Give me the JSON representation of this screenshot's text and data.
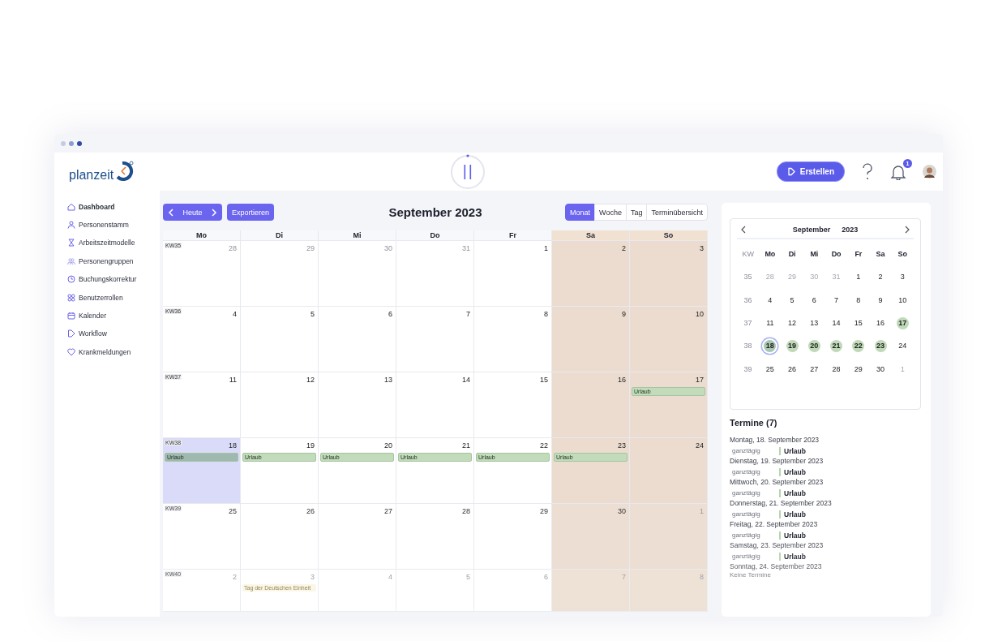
{
  "logo": {
    "text": "planzeit"
  },
  "header": {
    "create_button": "Erstellen",
    "notifications": "1"
  },
  "sidebar": {
    "items": [
      {
        "label": "Dashboard",
        "selected": true
      },
      {
        "label": "Personenstamm",
        "selected": false
      },
      {
        "label": "Arbeitszeitmodelle",
        "selected": false
      },
      {
        "label": "Personengruppen",
        "selected": false
      },
      {
        "label": "Buchungskorrektur",
        "selected": false
      },
      {
        "label": "Benutzerrollen",
        "selected": false
      },
      {
        "label": "Kalender",
        "selected": false
      },
      {
        "label": "Workflow",
        "selected": false
      },
      {
        "label": "Krankmeldungen",
        "selected": false
      }
    ]
  },
  "toolbar": {
    "today": "Heute",
    "export": "Exportieren",
    "title": "September 2023",
    "views": [
      {
        "label": "Monat",
        "selected": true
      },
      {
        "label": "Woche",
        "selected": false
      },
      {
        "label": "Tag",
        "selected": false
      },
      {
        "label": "Terminübersicht",
        "selected": false
      }
    ]
  },
  "calendar": {
    "columns": [
      {
        "label": "Mo",
        "weekend": false
      },
      {
        "label": "Di",
        "weekend": false
      },
      {
        "label": "Mi",
        "weekend": false
      },
      {
        "label": "Do",
        "weekend": false
      },
      {
        "label": "Fr",
        "weekend": false
      },
      {
        "label": "Sa",
        "weekend": true
      },
      {
        "label": "So",
        "weekend": true
      }
    ],
    "weeks": [
      {
        "kw": "KW35",
        "days": [
          {
            "num": "28",
            "muted": true,
            "selected": false
          },
          {
            "num": "29",
            "muted": true,
            "selected": false
          },
          {
            "num": "30",
            "muted": true,
            "selected": false
          },
          {
            "num": "31",
            "muted": true,
            "selected": false
          },
          {
            "num": "1",
            "muted": false,
            "selected": false
          },
          {
            "num": "2",
            "muted": false,
            "selected": false
          },
          {
            "num": "3",
            "muted": false,
            "selected": false
          }
        ]
      },
      {
        "kw": "KW36",
        "days": [
          {
            "num": "4",
            "muted": false,
            "selected": false
          },
          {
            "num": "5",
            "muted": false,
            "selected": false
          },
          {
            "num": "6",
            "muted": false,
            "selected": false
          },
          {
            "num": "7",
            "muted": false,
            "selected": false
          },
          {
            "num": "8",
            "muted": false,
            "selected": false
          },
          {
            "num": "9",
            "muted": false,
            "selected": false
          },
          {
            "num": "10",
            "muted": false,
            "selected": false
          }
        ]
      },
      {
        "kw": "KW37",
        "days": [
          {
            "num": "11",
            "muted": false,
            "selected": false
          },
          {
            "num": "12",
            "muted": false,
            "selected": false
          },
          {
            "num": "13",
            "muted": false,
            "selected": false
          },
          {
            "num": "14",
            "muted": false,
            "selected": false
          },
          {
            "num": "15",
            "muted": false,
            "selected": false
          },
          {
            "num": "16",
            "muted": false,
            "selected": false
          },
          {
            "num": "17",
            "muted": false,
            "selected": false,
            "events": [
              {
                "label": "Urlaub",
                "kind": "vacation"
              }
            ]
          }
        ]
      },
      {
        "kw": "KW38",
        "days": [
          {
            "num": "18",
            "muted": false,
            "selected": true,
            "events": [
              {
                "label": "Urlaub",
                "kind": "vacation"
              }
            ]
          },
          {
            "num": "19",
            "muted": false,
            "selected": false,
            "events": [
              {
                "label": "Urlaub",
                "kind": "vacation"
              }
            ]
          },
          {
            "num": "20",
            "muted": false,
            "selected": false,
            "events": [
              {
                "label": "Urlaub",
                "kind": "vacation"
              }
            ]
          },
          {
            "num": "21",
            "muted": false,
            "selected": false,
            "events": [
              {
                "label": "Urlaub",
                "kind": "vacation"
              }
            ]
          },
          {
            "num": "22",
            "muted": false,
            "selected": false,
            "events": [
              {
                "label": "Urlaub",
                "kind": "vacation"
              }
            ]
          },
          {
            "num": "23",
            "muted": false,
            "selected": false,
            "events": [
              {
                "label": "Urlaub",
                "kind": "vacation"
              }
            ]
          },
          {
            "num": "24",
            "muted": false,
            "selected": false
          }
        ]
      },
      {
        "kw": "KW39",
        "days": [
          {
            "num": "25",
            "muted": false,
            "selected": false
          },
          {
            "num": "26",
            "muted": false,
            "selected": false
          },
          {
            "num": "27",
            "muted": false,
            "selected": false
          },
          {
            "num": "28",
            "muted": false,
            "selected": false
          },
          {
            "num": "29",
            "muted": false,
            "selected": false
          },
          {
            "num": "30",
            "muted": false,
            "selected": false
          },
          {
            "num": "1",
            "muted": true,
            "selected": false
          }
        ]
      },
      {
        "kw": "KW40",
        "days": [
          {
            "num": "2",
            "muted": true,
            "selected": false
          },
          {
            "num": "3",
            "muted": true,
            "selected": false,
            "events": [
              {
                "label": "Tag der Deutschen Einheit",
                "kind": "holiday"
              }
            ]
          },
          {
            "num": "4",
            "muted": true,
            "selected": false
          },
          {
            "num": "5",
            "muted": true,
            "selected": false
          },
          {
            "num": "6",
            "muted": true,
            "selected": false
          },
          {
            "num": "7",
            "muted": true,
            "selected": false
          },
          {
            "num": "8",
            "muted": true,
            "selected": false
          }
        ]
      }
    ]
  },
  "mini_calendar": {
    "month": "September",
    "year": "2023",
    "columns": [
      "KW",
      "Mo",
      "Di",
      "Mi",
      "Do",
      "Fr",
      "Sa",
      "So"
    ],
    "weeks": [
      {
        "kw": "35",
        "days": [
          {
            "num": "28",
            "muted": true,
            "marked": false,
            "selected": false
          },
          {
            "num": "29",
            "muted": true,
            "marked": false,
            "selected": false
          },
          {
            "num": "30",
            "muted": true,
            "marked": false,
            "selected": false
          },
          {
            "num": "31",
            "muted": true,
            "marked": false,
            "selected": false
          },
          {
            "num": "1",
            "muted": false,
            "marked": false,
            "selected": false
          },
          {
            "num": "2",
            "muted": false,
            "marked": false,
            "selected": false
          },
          {
            "num": "3",
            "muted": false,
            "marked": false,
            "selected": false
          }
        ]
      },
      {
        "kw": "36",
        "days": [
          {
            "num": "4",
            "muted": false,
            "marked": false,
            "selected": false
          },
          {
            "num": "5",
            "muted": false,
            "marked": false,
            "selected": false
          },
          {
            "num": "6",
            "muted": false,
            "marked": false,
            "selected": false
          },
          {
            "num": "7",
            "muted": false,
            "marked": false,
            "selected": false
          },
          {
            "num": "8",
            "muted": false,
            "marked": false,
            "selected": false
          },
          {
            "num": "9",
            "muted": false,
            "marked": false,
            "selected": false
          },
          {
            "num": "10",
            "muted": false,
            "marked": false,
            "selected": false
          }
        ]
      },
      {
        "kw": "37",
        "days": [
          {
            "num": "11",
            "muted": false,
            "marked": false,
            "selected": false
          },
          {
            "num": "12",
            "muted": false,
            "marked": false,
            "selected": false
          },
          {
            "num": "13",
            "muted": false,
            "marked": false,
            "selected": false
          },
          {
            "num": "14",
            "muted": false,
            "marked": false,
            "selected": false
          },
          {
            "num": "15",
            "muted": false,
            "marked": false,
            "selected": false
          },
          {
            "num": "16",
            "muted": false,
            "marked": false,
            "selected": false
          },
          {
            "num": "17",
            "muted": false,
            "marked": true,
            "selected": false
          }
        ]
      },
      {
        "kw": "38",
        "days": [
          {
            "num": "18",
            "muted": false,
            "marked": true,
            "selected": true
          },
          {
            "num": "19",
            "muted": false,
            "marked": true,
            "selected": false
          },
          {
            "num": "20",
            "muted": false,
            "marked": true,
            "selected": false
          },
          {
            "num": "21",
            "muted": false,
            "marked": true,
            "selected": false
          },
          {
            "num": "22",
            "muted": false,
            "marked": true,
            "selected": false
          },
          {
            "num": "23",
            "muted": false,
            "marked": true,
            "selected": false
          },
          {
            "num": "24",
            "muted": false,
            "marked": false,
            "selected": false
          }
        ]
      },
      {
        "kw": "39",
        "days": [
          {
            "num": "25",
            "muted": false,
            "marked": false,
            "selected": false
          },
          {
            "num": "26",
            "muted": false,
            "marked": false,
            "selected": false
          },
          {
            "num": "27",
            "muted": false,
            "marked": false,
            "selected": false
          },
          {
            "num": "28",
            "muted": false,
            "marked": false,
            "selected": false
          },
          {
            "num": "29",
            "muted": false,
            "marked": false,
            "selected": false
          },
          {
            "num": "30",
            "muted": false,
            "marked": false,
            "selected": false
          },
          {
            "num": "1",
            "muted": true,
            "marked": false,
            "selected": false
          }
        ]
      }
    ]
  },
  "agenda": {
    "title": "Termine (7)",
    "days": [
      {
        "date": "Montag, 18. September 2023",
        "entries": [
          {
            "time": "ganztägig",
            "title": "Urlaub"
          }
        ]
      },
      {
        "date": "Dienstag, 19. September 2023",
        "entries": [
          {
            "time": "ganztägig",
            "title": "Urlaub"
          }
        ]
      },
      {
        "date": "Mittwoch, 20. September 2023",
        "entries": [
          {
            "time": "ganztägig",
            "title": "Urlaub"
          }
        ]
      },
      {
        "date": "Donnerstag, 21. September 2023",
        "entries": [
          {
            "time": "ganztägig",
            "title": "Urlaub"
          }
        ]
      },
      {
        "date": "Freitag, 22. September 2023",
        "entries": [
          {
            "time": "ganztägig",
            "title": "Urlaub"
          }
        ]
      },
      {
        "date": "Samstag, 23. September 2023",
        "entries": [
          {
            "time": "ganztägig",
            "title": "Urlaub"
          }
        ]
      },
      {
        "date": "Sonntag, 24. September 2023",
        "empty": "Keine Termine"
      }
    ]
  }
}
